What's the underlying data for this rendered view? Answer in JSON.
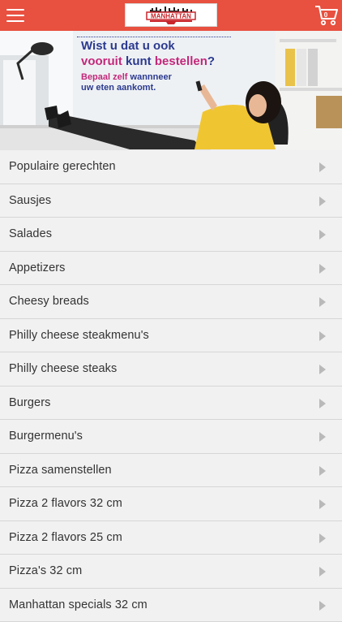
{
  "header": {
    "logo_text": "MANHATTAN",
    "menu_icon": "hamburger-menu-icon",
    "cart_icon": "shopping-cart-icon",
    "cart_count": "0",
    "accent_color": "#e8503f"
  },
  "banner": {
    "line1": "Wist u dat u ook",
    "line2_part1": "vooruit",
    "line2_part2": " kunt ",
    "line2_part3": "bestellen",
    "line2_part4": "?",
    "line3_part1": "Bepaal zelf",
    "line3_part2": " wannneer",
    "line4": "uw eten aankomt.",
    "text_color": "#2b3a8f",
    "highlight_color": "#c2287a"
  },
  "menu": {
    "items": [
      {
        "label": "Populaire gerechten"
      },
      {
        "label": "Sausjes"
      },
      {
        "label": "Salades"
      },
      {
        "label": "Appetizers"
      },
      {
        "label": "Cheesy breads"
      },
      {
        "label": "Philly cheese steakmenu's"
      },
      {
        "label": "Philly cheese steaks"
      },
      {
        "label": "Burgers"
      },
      {
        "label": "Burgermenu's"
      },
      {
        "label": "Pizza samenstellen"
      },
      {
        "label": "Pizza 2 flavors 32 cm"
      },
      {
        "label": "Pizza 2 flavors 25 cm"
      },
      {
        "label": "Pizza's 32 cm"
      },
      {
        "label": "Manhattan specials 32 cm"
      }
    ],
    "chevron_icon": "chevron-right-icon"
  }
}
